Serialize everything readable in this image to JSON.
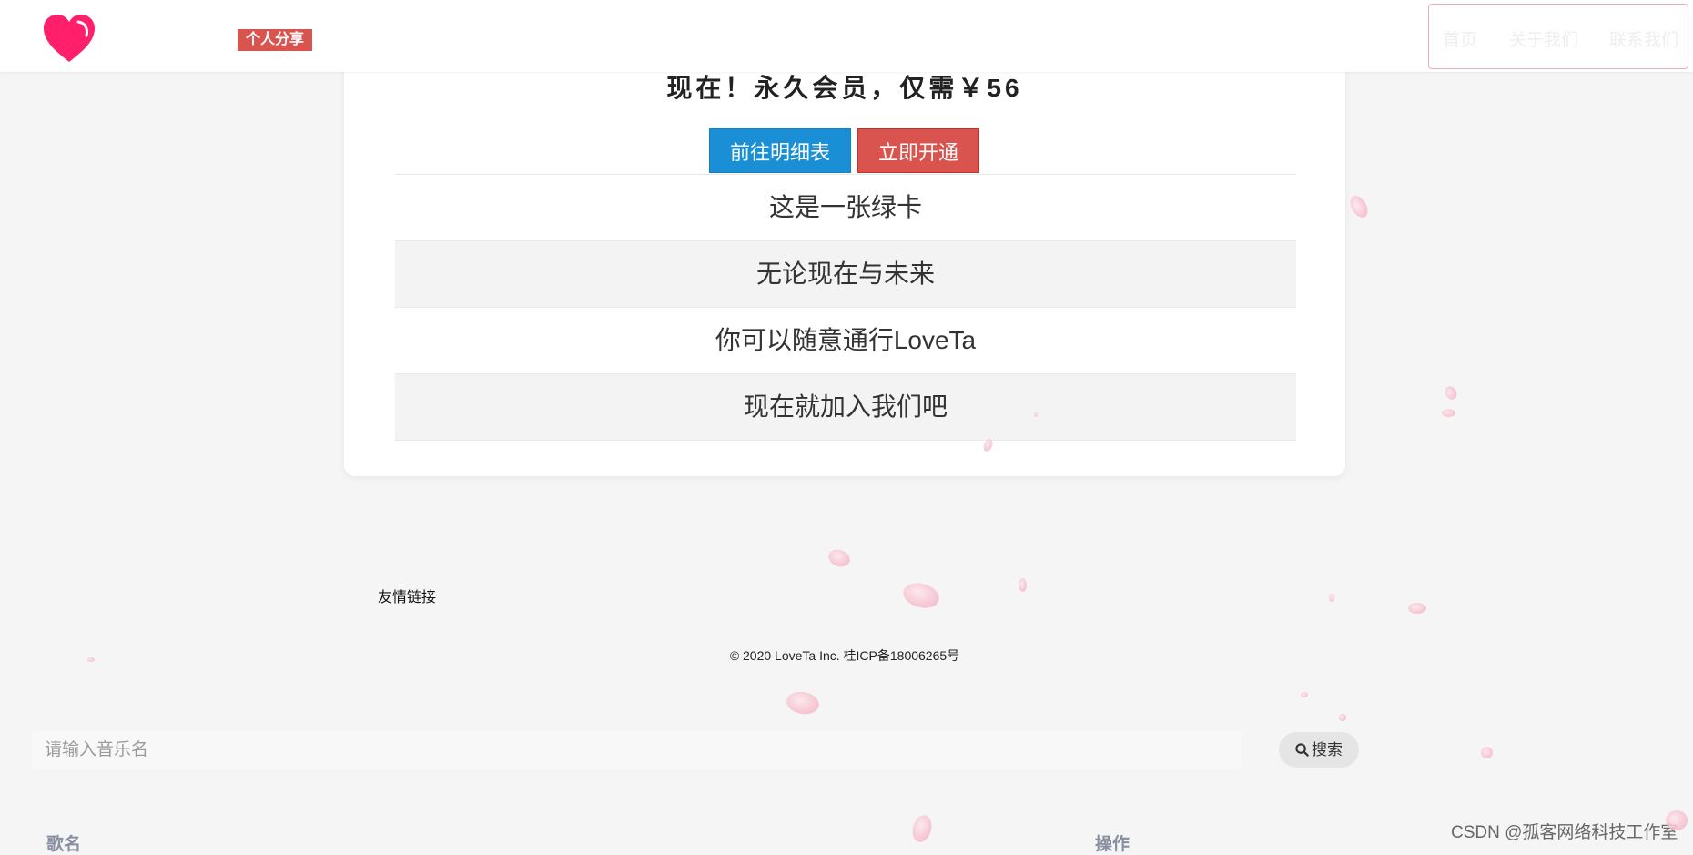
{
  "header": {
    "badge": "个人分享",
    "nav": [
      "首页",
      "关于我们",
      "联系我们"
    ]
  },
  "card": {
    "promo": "现在！永久会员，仅需￥56",
    "buttons": {
      "detail": "前往明细表",
      "open": "立即开通"
    },
    "rows": [
      "这是一张绿卡",
      "无论现在与未来",
      "你可以随意通行LoveTa",
      "现在就加入我们吧"
    ]
  },
  "footer": {
    "links_label": "友情链接",
    "copyright": "© 2020 LoveTa Inc. 桂ICP备18006265号"
  },
  "search": {
    "placeholder": "请输入音乐名",
    "button_label": "搜索"
  },
  "table": {
    "col_song": "歌名",
    "col_ops": "操作"
  },
  "watermark": "CSDN @孤客网络科技工作室",
  "icons": {
    "logo": "heart-icon",
    "search": "search-icon",
    "decor": "petal-icon"
  },
  "colors": {
    "accent_red": "#d9534f",
    "accent_blue": "#1a8fd6",
    "heart": "#ff1f6b"
  }
}
